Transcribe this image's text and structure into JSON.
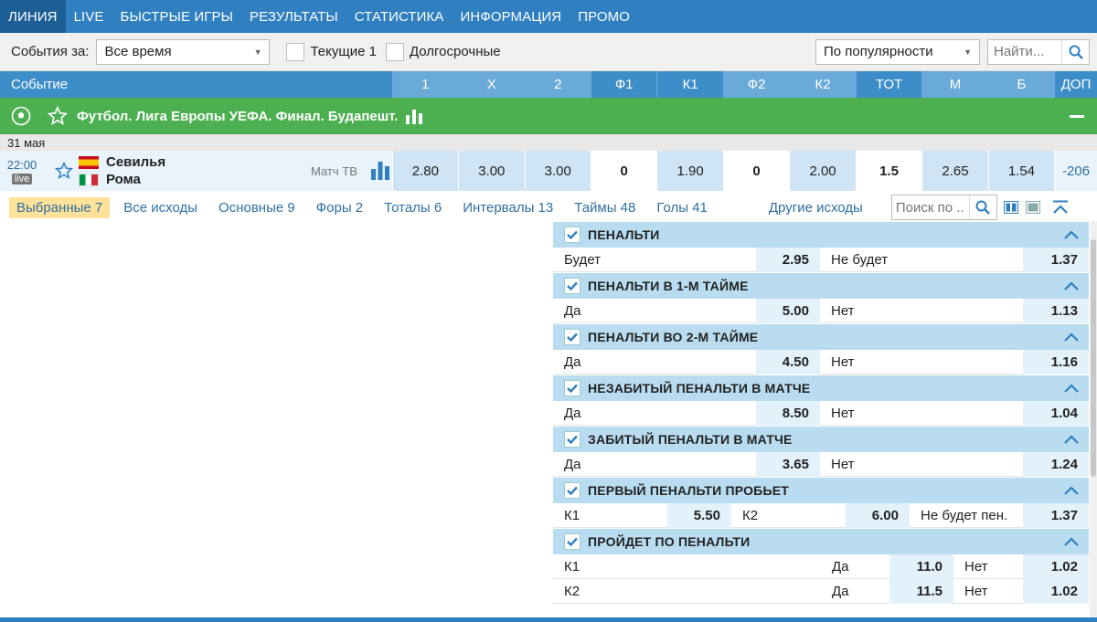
{
  "nav": [
    "ЛИНИЯ",
    "LIVE",
    "БЫСТРЫЕ ИГРЫ",
    "РЕЗУЛЬТАТЫ",
    "СТАТИСТИКА",
    "ИНФОРМАЦИЯ",
    "ПРОМО"
  ],
  "filters": {
    "events_for_label": "События за:",
    "period_value": "Все время",
    "current_label": "Текущие 1",
    "longterm_label": "Долгосрочные",
    "sort_value": "По популярности",
    "search_placeholder": "Найти..."
  },
  "header": {
    "event_label": "Событие",
    "columns": [
      "1",
      "X",
      "2",
      "Ф1",
      "К1",
      "Ф2",
      "К2",
      "ТОТ",
      "М",
      "Б",
      "ДОП"
    ]
  },
  "category": {
    "title": "Футбол. Лига Европы УЕФА. Финал. Будапешт."
  },
  "date": "31 мая",
  "event": {
    "time": "22:00",
    "live_badge": "live",
    "team1": "Севилья",
    "team2": "Рома",
    "tv_label": "Матч ТВ",
    "odds": [
      "2.80",
      "3.00",
      "3.00",
      "0",
      "1.90",
      "0",
      "2.00",
      "1.5",
      "2.65",
      "1.54",
      "-206"
    ]
  },
  "tabs": {
    "items": [
      "Выбранные 7",
      "Все исходы",
      "Основные 9",
      "Форы 2",
      "Тоталы 6",
      "Интервалы 13",
      "Таймы 48",
      "Голы 41"
    ],
    "other_label": "Другие исходы",
    "search_placeholder": "Поиск по ..."
  },
  "markets": [
    {
      "title": "ПЕНАЛЬТИ",
      "rows": [
        [
          "Будет",
          "2.95",
          "Не будет",
          "1.37"
        ]
      ]
    },
    {
      "title": "ПЕНАЛЬТИ В 1-М ТАЙМЕ",
      "rows": [
        [
          "Да",
          "5.00",
          "Нет",
          "1.13"
        ]
      ]
    },
    {
      "title": "ПЕНАЛЬТИ ВО 2-М ТАЙМЕ",
      "rows": [
        [
          "Да",
          "4.50",
          "Нет",
          "1.16"
        ]
      ]
    },
    {
      "title": "НЕЗАБИТЫЙ ПЕНАЛЬТИ В МАТЧЕ",
      "rows": [
        [
          "Да",
          "8.50",
          "Нет",
          "1.04"
        ]
      ]
    },
    {
      "title": "ЗАБИТЫЙ ПЕНАЛЬТИ В МАТЧЕ",
      "rows": [
        [
          "Да",
          "3.65",
          "Нет",
          "1.24"
        ]
      ]
    },
    {
      "title": "ПЕРВЫЙ ПЕНАЛЬТИ ПРОБЬЕТ",
      "rows": [
        [
          "К1",
          "5.50",
          "К2",
          "6.00",
          "Не будет пен.",
          "1.37"
        ]
      ]
    },
    {
      "title": "ПРОЙДЕТ ПО ПЕНАЛЬТИ",
      "rows": [
        [
          "К1",
          "Да",
          "11.0",
          "Нет",
          "1.02"
        ],
        [
          "К2",
          "Да",
          "11.5",
          "Нет",
          "1.02"
        ]
      ]
    }
  ],
  "colors": {
    "nav": "#2f7fc1",
    "category": "#4caf50",
    "market_header": "#b9dcf0",
    "odd_cell": "#e3f1fa",
    "selected_tab": "#ffe29a"
  }
}
